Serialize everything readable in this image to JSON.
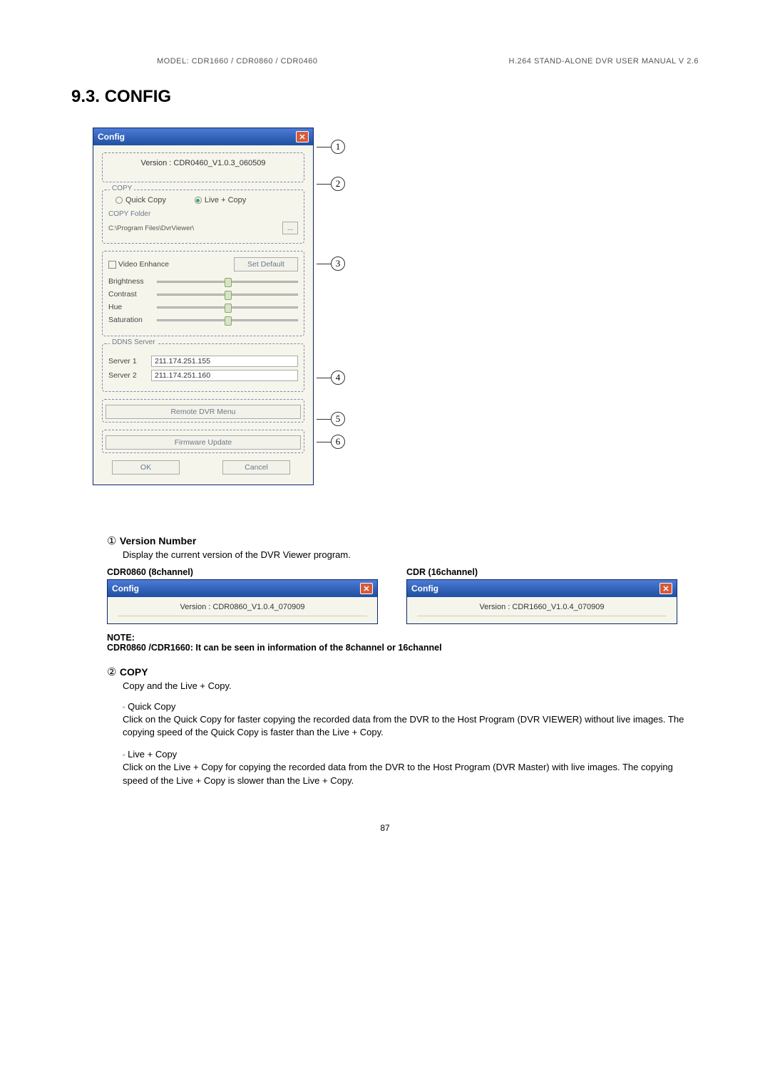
{
  "header": {
    "left": "MODEL: CDR1660 / CDR0860 / CDR0460",
    "right": "H.264 STAND-ALONE DVR USER MANUAL V 2.6"
  },
  "section_title": "9.3.  CONFIG",
  "dialog": {
    "title": "Config",
    "version": "Version : CDR0460_V1.0.3_060509",
    "copy": {
      "legend": "COPY",
      "quick": "Quick Copy",
      "live": "Live + Copy",
      "folder_legend": "COPY Folder",
      "folder_path": "C:\\Program Files\\DvrViewer\\",
      "ellipsis": "..."
    },
    "video": {
      "enhance_label": "Video Enhance",
      "set_default": "Set Default",
      "brightness": "Brightness",
      "contrast": "Contrast",
      "hue": "Hue",
      "saturation": "Saturation"
    },
    "ddns": {
      "legend": "DDNS Server",
      "s1_label": "Server 1",
      "s1_val": "211.174.251.155",
      "s2_label": "Server 2",
      "s2_val": "211.174.251.160"
    },
    "remote_btn": "Remote DVR Menu",
    "firmware_btn": "Firmware Update",
    "ok": "OK",
    "cancel": "Cancel"
  },
  "content": {
    "item1": {
      "num": "①",
      "title": "Version Number",
      "desc": "Display the current version of the DVR Viewer program.",
      "leftH": "CDR0860 (8channel)",
      "rightH": "CDR (16channel)",
      "miniTitle": "Config",
      "leftV": "Version : CDR0860_V1.0.4_070909",
      "rightV": "Version : CDR1660_V1.0.4_070909",
      "noteH": "NOTE:",
      "noteB": "CDR0860 /CDR1660: It can be seen in information of the 8channel or 16channel"
    },
    "item2": {
      "num": "②",
      "title": "COPY",
      "desc": "Copy and the Live + Copy.",
      "b1_label": "Quick Copy",
      "b1_text": "Click on the Quick Copy for faster copying the recorded data from the DVR to the Host Program (DVR VIEWER) without live images. The copying speed of the Quick Copy is faster than the Live + Copy.",
      "b2_label": "Live + Copy",
      "b2_text": "Click on the Live + Copy for copying the recorded data from the DVR to the Host Program (DVR Master) with live images. The copying speed of the Live + Copy is slower than the Live + Copy."
    }
  },
  "page_num": "87"
}
